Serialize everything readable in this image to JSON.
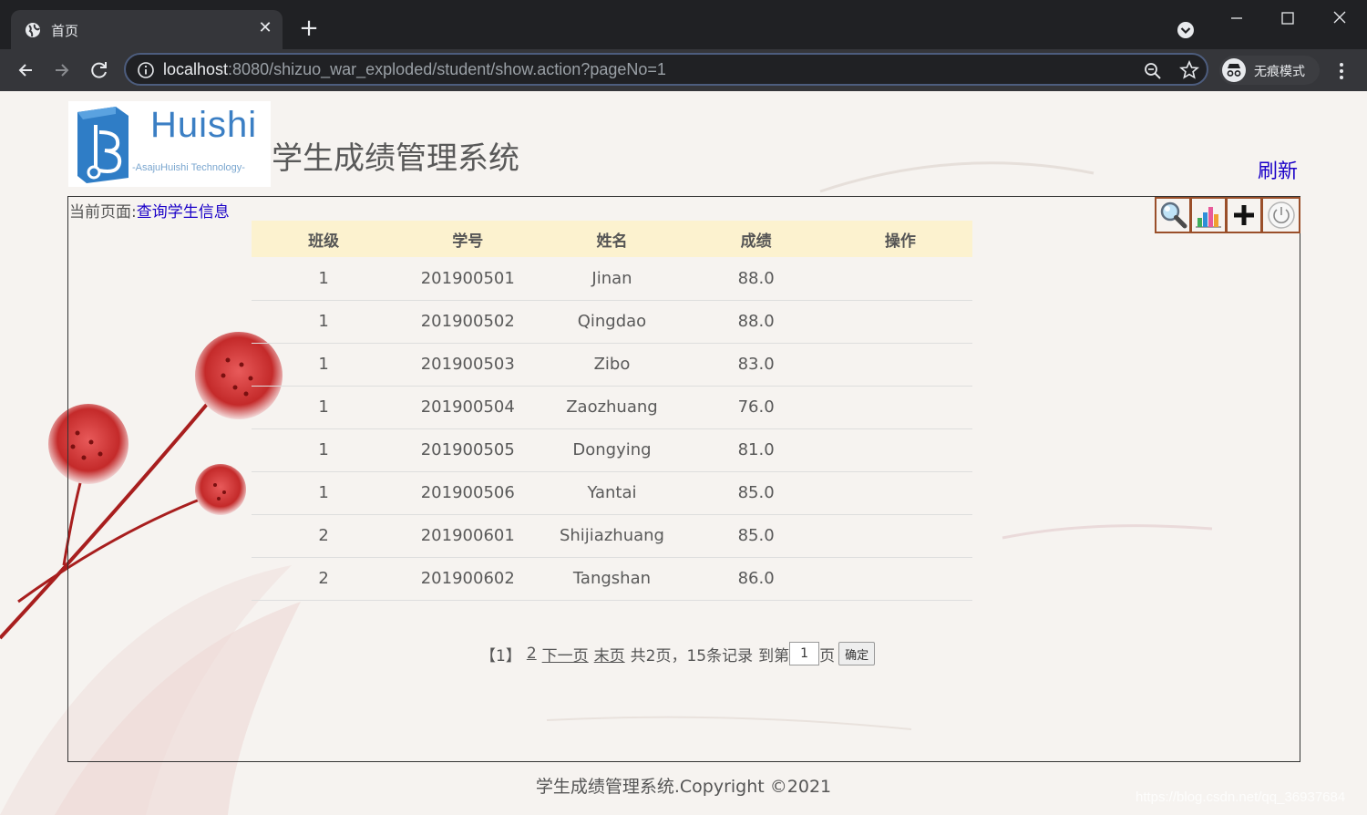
{
  "browser": {
    "tab_title": "首页",
    "url_host": "localhost",
    "url_rest": ":8080/shizuo_war_exploded/student/show.action?pageNo=1",
    "incognito_label": "无痕模式"
  },
  "header": {
    "logo_text": "Huishi",
    "logo_subtext": "-AsajuHuishi Technology-",
    "site_title": "学生成绩管理系统",
    "refresh_label": "刷新"
  },
  "breadcrumb": {
    "prefix": "当前页面:",
    "current": "查询学生信息"
  },
  "toolbox": {
    "icons": [
      "search-icon",
      "chart-icon",
      "add-icon",
      "power-icon"
    ]
  },
  "table": {
    "headers": [
      "班级",
      "学号",
      "姓名",
      "成绩",
      "操作"
    ],
    "rows": [
      {
        "cls": "1",
        "id": "201900501",
        "name": "Jinan",
        "score": "88.0",
        "op": ""
      },
      {
        "cls": "1",
        "id": "201900502",
        "name": "Qingdao",
        "score": "88.0",
        "op": ""
      },
      {
        "cls": "1",
        "id": "201900503",
        "name": "Zibo",
        "score": "83.0",
        "op": ""
      },
      {
        "cls": "1",
        "id": "201900504",
        "name": "Zaozhuang",
        "score": "76.0",
        "op": ""
      },
      {
        "cls": "1",
        "id": "201900505",
        "name": "Dongying",
        "score": "81.0",
        "op": ""
      },
      {
        "cls": "1",
        "id": "201900506",
        "name": "Yantai",
        "score": "85.0",
        "op": ""
      },
      {
        "cls": "2",
        "id": "201900601",
        "name": "Shijiazhuang",
        "score": "85.0",
        "op": ""
      },
      {
        "cls": "2",
        "id": "201900602",
        "name": "Tangshan",
        "score": "86.0",
        "op": ""
      }
    ]
  },
  "pager": {
    "current": "【1】",
    "page2": "2",
    "next": "下一页",
    "last": "末页",
    "summary": "共2页，15条记录",
    "goto_prefix": "到第",
    "goto_value": "1",
    "goto_suffix": "页",
    "confirm": "确定"
  },
  "footer": {
    "copyright": "学生成绩管理系统.Copyright ©2021",
    "watermark": "https://blog.csdn.net/qq_36937684"
  },
  "colors": {
    "link": "#1a00c8",
    "table_header_bg": "#fcf2cf",
    "toolbox_border": "#9a4f2a"
  }
}
